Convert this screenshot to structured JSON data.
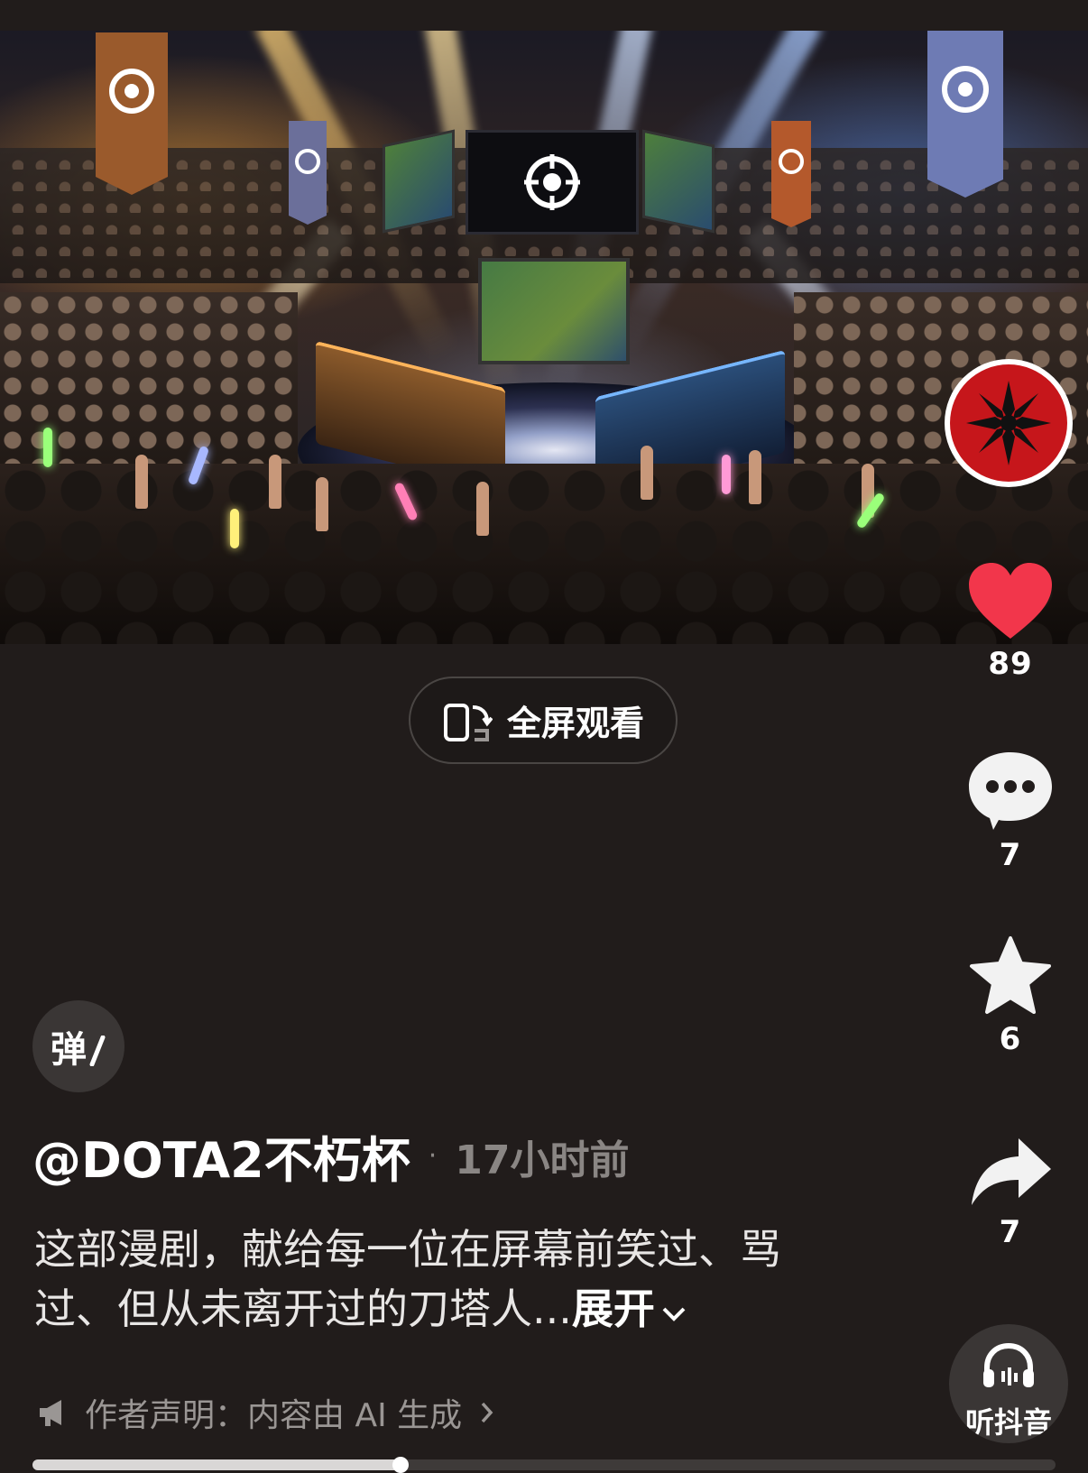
{
  "video": {
    "scene": "esports-arena",
    "progress_fraction": 0.36
  },
  "actions": {
    "like_count": "89",
    "comment_count": "7",
    "favorite_count": "6",
    "share_count": "7"
  },
  "fullscreen": {
    "label": "全屏观看"
  },
  "danmaku": {
    "label": "弹"
  },
  "post": {
    "author": "@DOTA2不朽杯",
    "separator": "·",
    "time": "17小时前",
    "caption": "这部漫剧，献给每一位在屏幕前笑过、骂过、但从未离开过的刀塔人...",
    "expand_label": "展开"
  },
  "statement": {
    "label": "作者声明：内容由 AI 生成"
  },
  "listen": {
    "label": "听抖音"
  },
  "colors": {
    "background": "#211c1b",
    "like_red": "#f2364b",
    "avatar_red": "#c6161b"
  }
}
